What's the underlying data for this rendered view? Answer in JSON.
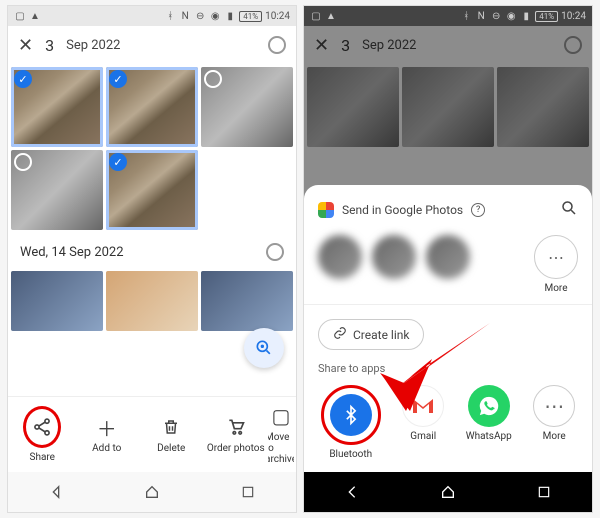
{
  "status": {
    "battery": "41%",
    "time": "10:24"
  },
  "left": {
    "count": "3",
    "date_frag": "Sep 2022",
    "section_date": "Wed, 14 Sep 2022",
    "actions": {
      "share": "Share",
      "addto": "Add to",
      "delete": "Delete",
      "order": "Order photos",
      "move": "Move to archive"
    }
  },
  "right": {
    "sheet_title": "Send in Google Photos",
    "more": "More",
    "create_link": "Create link",
    "share_apps_label": "Share to apps",
    "apps": {
      "bluetooth": "Bluetooth",
      "gmail": "Gmail",
      "whatsapp": "WhatsApp",
      "more": "More"
    }
  }
}
